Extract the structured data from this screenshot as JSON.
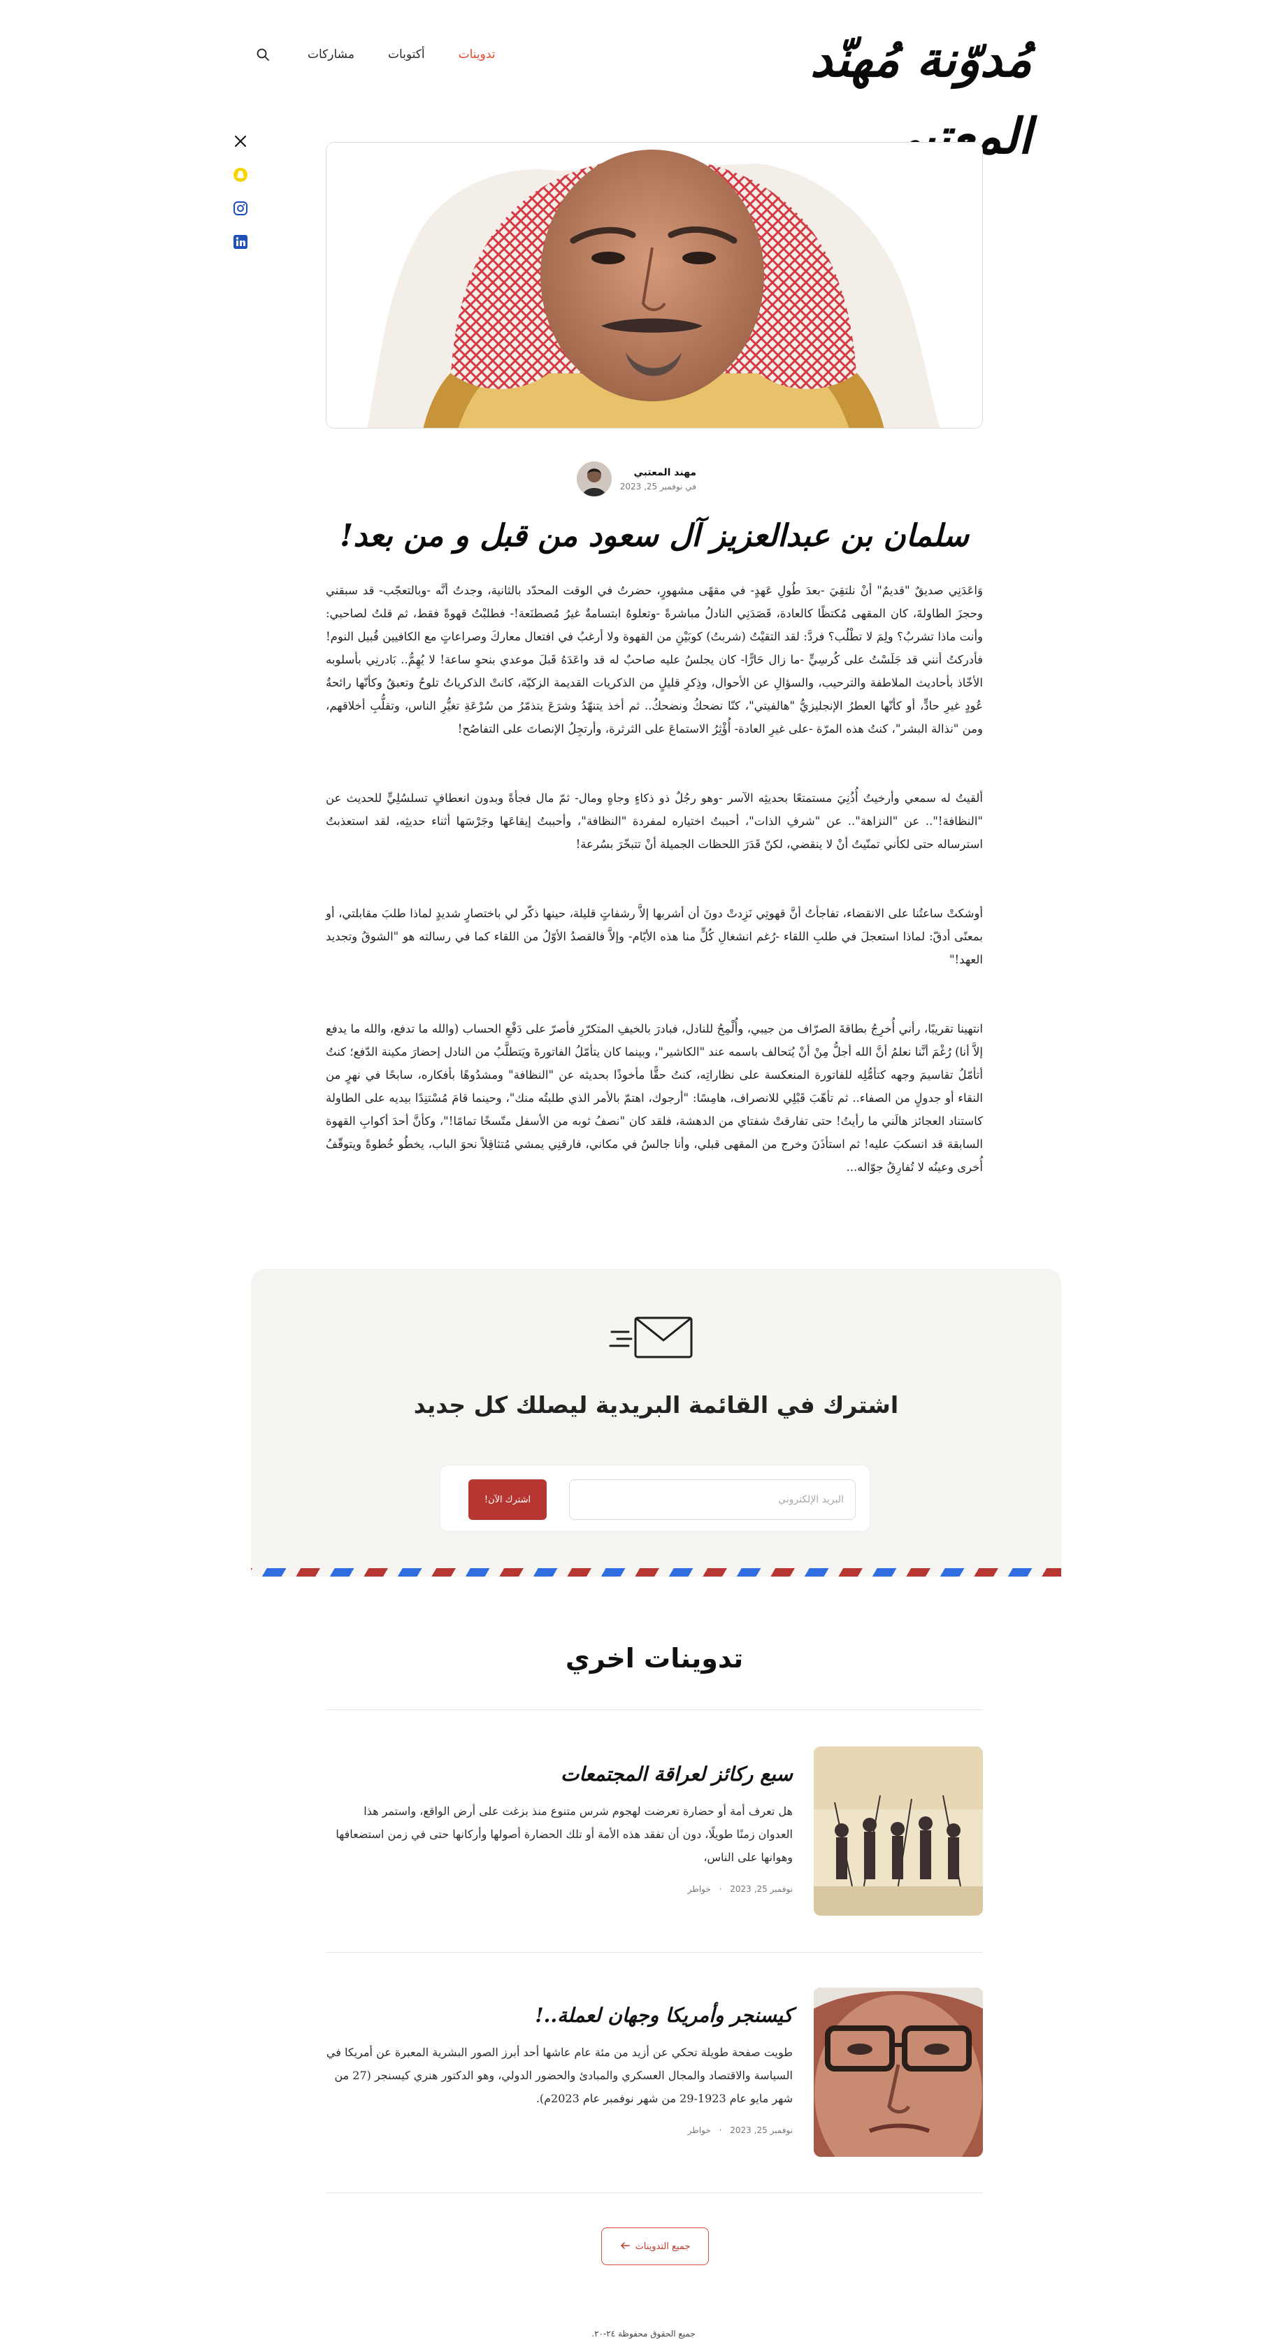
{
  "site": {
    "logo_text": "مُدوّنة مُهنّد المعتبي"
  },
  "nav": {
    "items": [
      {
        "label": "تدوينات",
        "active": true
      },
      {
        "label": "أكتوبات",
        "active": false
      },
      {
        "label": "مشاركات",
        "active": false
      }
    ],
    "search_icon": "search-icon"
  },
  "social": [
    {
      "name": "x-icon",
      "color": "#111111"
    },
    {
      "name": "snapchat-icon",
      "color": "#f5d400"
    },
    {
      "name": "instagram-icon",
      "color": "#1f4fb8"
    },
    {
      "name": "linkedin-icon",
      "color": "#1f4fb8"
    }
  ],
  "post": {
    "author_name": "مهند المعتبي",
    "date": "في نوفمبر 25, 2023",
    "title": "سلمان بن عبدالعزيز آل سعود من قبل و من بعد!",
    "paragraphs": [
      "وَاعَدَنِي صديقٌ \"قديمٌ\" أنْ نلتقِيَ -بعدَ طُولِ عَهدٍ- في مقهًى مشهورٍ، حضرتُ في الوقت المحدّد بالثانية، وجدتُ أنَّه -وبالتعجّب- قد سبقني وحجزَ الطاولةَ، كان المقهى مُكتظًا كالعادة، قَصَدَنِي النادلُ مباشرةً -وتعلوهُ ابتسامةٌ غيرُ مُصطنَعة!- فطلبْتُ قهوةً فقط، ثم قلتُ لصاحبي: وأنت ماذا تشربُ؟ ولِمَ لا تطْلُب؟ فردَّ: لقد التقيْتُ (شربتُ) كوبَيْنِ من القهوة ولا أرغبُ في افتعال معاركَ وصراعاتٍ مع الكافيين قُبيل النوم! فأدركتُ أنني قد جَلَسْتُ على كُرسِيٍّ -ما زال حَارًّا- كان يجلسُ عليه صاحبٌ له قد واعَدَهُ قَبلَ موعدي بنحوِ ساعة! لا يُهِمُّ.. بَادرنِي بأسلوبه الأخّاذ بأحاديث الملاطفة والترحيب، والسؤالِ عن الأحوال، وذِكرِ قليلٍ من الذكريات القديمة الزكيّة، كانتْ الذكرياتُ تلوحُ وتعبقُ وكأنّها رائحةُ عُودٍ غيرِ حادٍّ، أو كأنّها العطرُ الإنجليزيُّ \"هالفيتي\"، كنّا نضحكُ ونضحكُ.. ثم أخذ يتنهّدُ وشرَعَ يتذمّرُ من سُرْعَةِ تغيُّرِ الناس، وتقلُّبِ أخلاقهم، ومن \"نذالة البشر\"، كنتُ هذه المرّة -على غيرِ العادة- أُؤْثِرُ الاستماعَ على الثرثرة، وأرتجِلُ الإنصاتَ على التفاصُح!",
      "ألقيتُ له سمعي وأرخيتُ أُذُنِيَ مستمتعًا بحديثِه الآسر -وهو رجُلٌ ذو ذكاءٍ وجاهٍ ومال- ثمّ مال فجأةً وبدون انعطافٍ تسلسُلِيٍّ للحديث عن \"النظافة!\".. عن \"النزاهة\".. عن \"شرفِ الذات\"، أحببتُ اختياره لمفردة \"النظافة\"، وأحببتُ إيقاعَها وجَرْسَها أثناء حديثِه، لقد استعذبتُ استرساله حتى لكأني تمنّيتُ أنْ لا ينقضي، لكنّ قَدَرَ اللحظات الجميلة أنْ تتبخّرَ بسُرعة!",
      "أوشكتْ ساعتُنا على الانقضاء، تفاجأتُ أنَّ قهوتِي نَزِدتْ دونَ أن أشربها إلاَّ رشفاتٍ قليلة، حينها ذكّر لي باختصارٍ شديدٍ لماذا طلبَ مقابلتي، أو بمعنًى أدقّ: لماذا استعجلَ في طلبِ اللقاء -رُغم انشغالِ كُلٍّ منا هذه الأيّام- وإلاَّ فالقصدُ الأوّلُ من اللقاء كما في رسالته هو \"الشوقُ وتجديد العهد!\"",
      "انتهينا تقريبًا، رأني أُخرِجُ بطاقةَ الصرّاف من جيبي، وأُلْمِحُ للنادل، فبادرَ بالخيفِ المتكرّرِ فأصرّ على دَفْعِ الحساب (والله ما تدفع، والله ما يدفع إلاَّ أنا) رُغْمَ أنَّنا نعلمُ أنَّ الله أجلُّ مِنْ أنْ يُتحالف باسمه عند \"الكاشير\"، وبينما كان يتأمّلُ الفاتورةَ ويَتطلَّبُ من النادل إحضارَ مكينة الدّفع؛ كنتُ أتأمّلُ تقاسيمَ وجهه كتأمُّلِه للفاتورة المنعكسة على نظاراتِه، كنتُ حقًّا مأخوذًا بحديثه عن \"النظافة\" ومشدُوهًا بأفكاره، سابحًا في نهرٍ من النقاء أو جدولٍ من الصفاء.. ثم تأهّبَ قَبْلِي للانصراف، هامِسًا: \"أرجوك، اهتمّ بالأمر الذي طلبتُه منك\"، وحينما قامَ مُسْتنِدًا بيديه على الطاولة كاستناد العجائز هالَني ما رأيتُ! حتى تفارقتْ شفتاي من الدهشة، فلقد كان \"نصفُ ثوبه من الأسفل متّسخًا تمامًا!\"، وكأنَّ أحدَ أكوابِ القهوة السابقة قد انسكبَ عليه! ثم استأذَنَ وخرج من المقهى قبلي، وأنا جالسٌ في مكاني، فارقنِي يمشي مُتثاقِلاً نحوَ الباب، يخطُو خُطوةً ويتوقّفُ أُخرى وعينُه لا تُفارِقُ جوّاله..."
    ]
  },
  "newsletter": {
    "icon": "envelope-icon",
    "title": "اشترك في القائمة البريدية ليصلك كل جديد",
    "input_placeholder": "البريد الإلكتروني",
    "button_label": "اشترك الآن!"
  },
  "related": {
    "heading": "تدوينات اخري",
    "posts": [
      {
        "title": "سبع ركائز لعراقة المجتمعات",
        "excerpt": "هل تعرف أمة أو حضارة تعرضت لهجوم شرس متنوع منذ بزغت على أرض الواقع، واستمر هذا العدوان زمنًا طويلًا، دون أن تفقد هذه الأمة أو تلك الحضارة أصولها وأركانها حتى في زمن استضعافها وهوانها على الناس،",
        "date": "نوفمبر 25, 2023",
        "category": "خواطر"
      },
      {
        "title": "كيسنجر وأمريكا وجهان لعملة..!",
        "excerpt": "طويت صفحة طويلة تحكي عن أزيد من مئة عام عاشها أحد أبرز الصور البشرية المعبرة عن أمريكا في السياسة والاقتصاد والمجال العسكري والمبادئ والحضور الدولي، وهو الدكتور هنري كيسنجر (27 من شهر مايو عام 1923-29 من شهر نوفمبر عام 2023م).",
        "date": "نوفمبر 25, 2023",
        "category": "خواطر"
      }
    ],
    "all_posts_label": "جميع التدوينات"
  },
  "footer": {
    "copyright": "جميع الحقوق محفوظة ٢٤-٢٠."
  }
}
